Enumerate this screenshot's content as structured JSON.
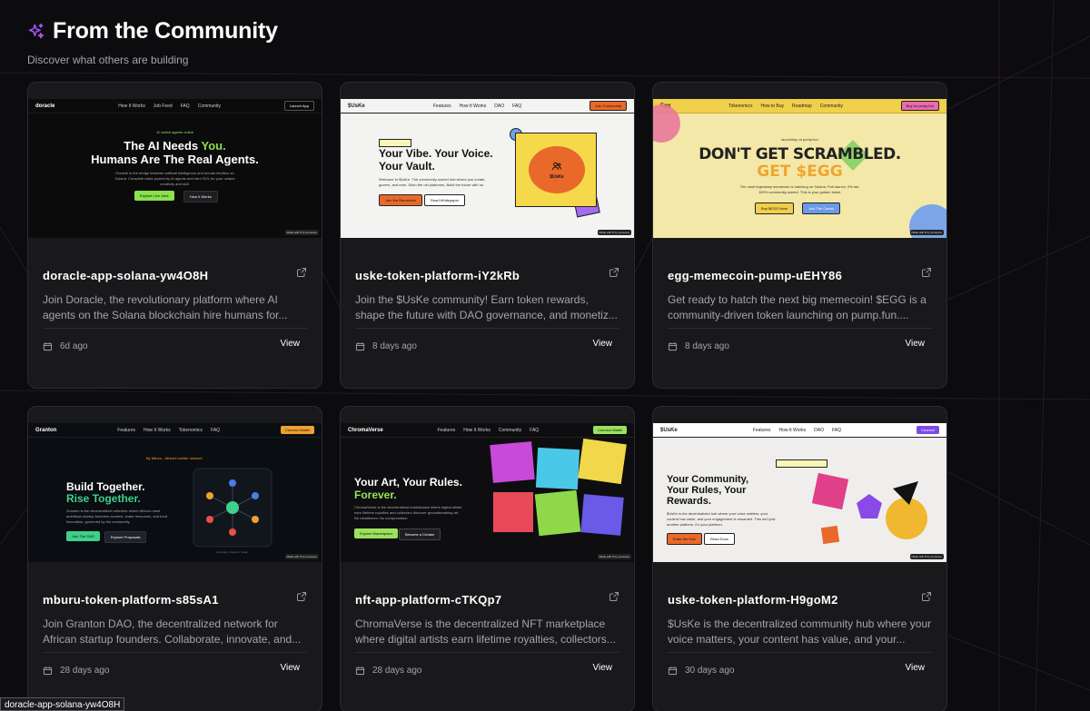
{
  "header": {
    "title": "From the Community",
    "subtitle": "Discover what others are building"
  },
  "cards": [
    {
      "name": "doracle-app-solana-yw4O8H",
      "description": "Join Doracle, the revolutionary platform where AI agents on the Solana blockchain hire humans for...",
      "time": "6d ago",
      "view_label": "View",
      "preview": {
        "brand": "doracle",
        "nav": [
          "How It Works",
          "Job Feed",
          "FAQ",
          "Community"
        ],
        "cta": "Launch App",
        "badge": "10 active agents online",
        "headline_1a": "The AI Needs ",
        "headline_1b": "You.",
        "headline_2": "Humans Are The Real Agents.",
        "body": "Doracle is the bridge between artificial intelligence and human intuition on Solana. Complete tasks posted by AI agents and earn SOL for your unique creativity and skill.",
        "btn_primary": "Explore Live Jobs",
        "btn_secondary": "How It Works"
      }
    },
    {
      "name": "uske-token-platform-iY2kRb",
      "description": "Join the $UsKe community! Earn token rewards, shape the future with DAO governance, and monetiz...",
      "time": "8 days ago",
      "view_label": "View",
      "preview": {
        "brand": "$UsKe",
        "nav": [
          "Features",
          "How It Works",
          "DAO",
          "FAQ"
        ],
        "cta": "Join Community",
        "badge": "LIVE on Solana",
        "headline_1": "Your Vibe. Your Voice.",
        "headline_2": "Your Vault.",
        "body": "Welcome to $UsKe. The community-owned hub where you create, govern, and earn. Ditch the old platforms. Build the future with us.",
        "btn_primary": "Join the Revolution",
        "btn_secondary": "Read Whitepaper",
        "logo_text": "$UsKe"
      }
    },
    {
      "name": "egg-memecoin-pump-uEHY86",
      "description": "Get ready to hatch the next big memecoin! $EGG is a community-driven token launching on pump.fun....",
      "time": "8 days ago",
      "view_label": "View",
      "preview": {
        "brand": "Egg",
        "nav": [
          "Tokenomics",
          "How to Buy",
          "Roadmap",
          "Community"
        ],
        "cta": "Buy on pump.fun",
        "badge": "launching on pump.fun",
        "headline_1": "DON'T GET SCRAMBLED.",
        "headline_2": "GET $EGG",
        "body": "The most legendary memecoin is hatching on Solana. Fair launch, 0% tax, 100% community-owned. This is your golden ticket.",
        "btn_primary": "Buy $EGG Now!",
        "btn_secondary": "Join The Carton"
      }
    },
    {
      "name": "mburu-token-platform-s85sA1",
      "description": "Join Granton DAO, the decentralized network for African startup founders. Collaborate, innovate, and...",
      "time": "28 days ago",
      "view_label": "View",
      "preview": {
        "brand": "Granton",
        "nav": [
          "Features",
          "How It Works",
          "Tokenomics",
          "FAQ"
        ],
        "cta": "Connect Wallet",
        "badge": "By Mburu - Africa's builder network",
        "headline_1": "Build Together.",
        "headline_2": "Rise Together.",
        "body": "Granton is the decentralized collective where Africa's most ambitious startup founders connect, share resources, and fund innovation, governed by the community.",
        "btn_primary": "Join The DAO",
        "btn_secondary": "Explore Proposals",
        "caption": "Founders. Network. Scale."
      }
    },
    {
      "name": "nft-app-platform-cTKQp7",
      "description": "ChromaVerse is the decentralized NFT marketplace where digital artists earn lifetime royalties, collectors...",
      "time": "28 days ago",
      "view_label": "View",
      "preview": {
        "brand": "ChromaVerse",
        "nav": [
          "Features",
          "How It Works",
          "Community",
          "FAQ"
        ],
        "cta": "Connect Wallet",
        "headline_1": "Your Art, Your Rules.",
        "headline_2": "Forever.",
        "body": "ChromaVerse is the decentralized marketplace where digital artists earn lifetime royalties and collectors discover groundbreaking art. No middlemen. No compromises.",
        "btn_primary": "Explore Marketplace",
        "btn_secondary": "Become a Creator"
      }
    },
    {
      "name": "uske-token-platform-H9goM2",
      "description": "$UsKe is the decentralized community hub where your voice matters, your content has value, and your...",
      "time": "30 days ago",
      "view_label": "View",
      "preview": {
        "brand": "$UsKe",
        "nav": [
          "Features",
          "How It Works",
          "DAO",
          "FAQ"
        ],
        "cta": "Connect",
        "badge": "LIVE updates now available",
        "headline_1": "Your Community,",
        "headline_2": "Your Rules, Your",
        "headline_3": "Rewards.",
        "body": "$UsKe is the decentralized hub where your voice matters, your content has value, and your engagement is rewarded. This isn't just another platform, it's your platform.",
        "btn_primary": "Enter the Hub",
        "btn_secondary": "Read Docs"
      }
    }
  ],
  "made_with": "Made with ♥ by someone",
  "tooltip": "doracle-app-solana-yw4O8H",
  "colors": {
    "accent_purple": "#a855f7",
    "background": "#0c0b0e",
    "card": "#19181b"
  }
}
